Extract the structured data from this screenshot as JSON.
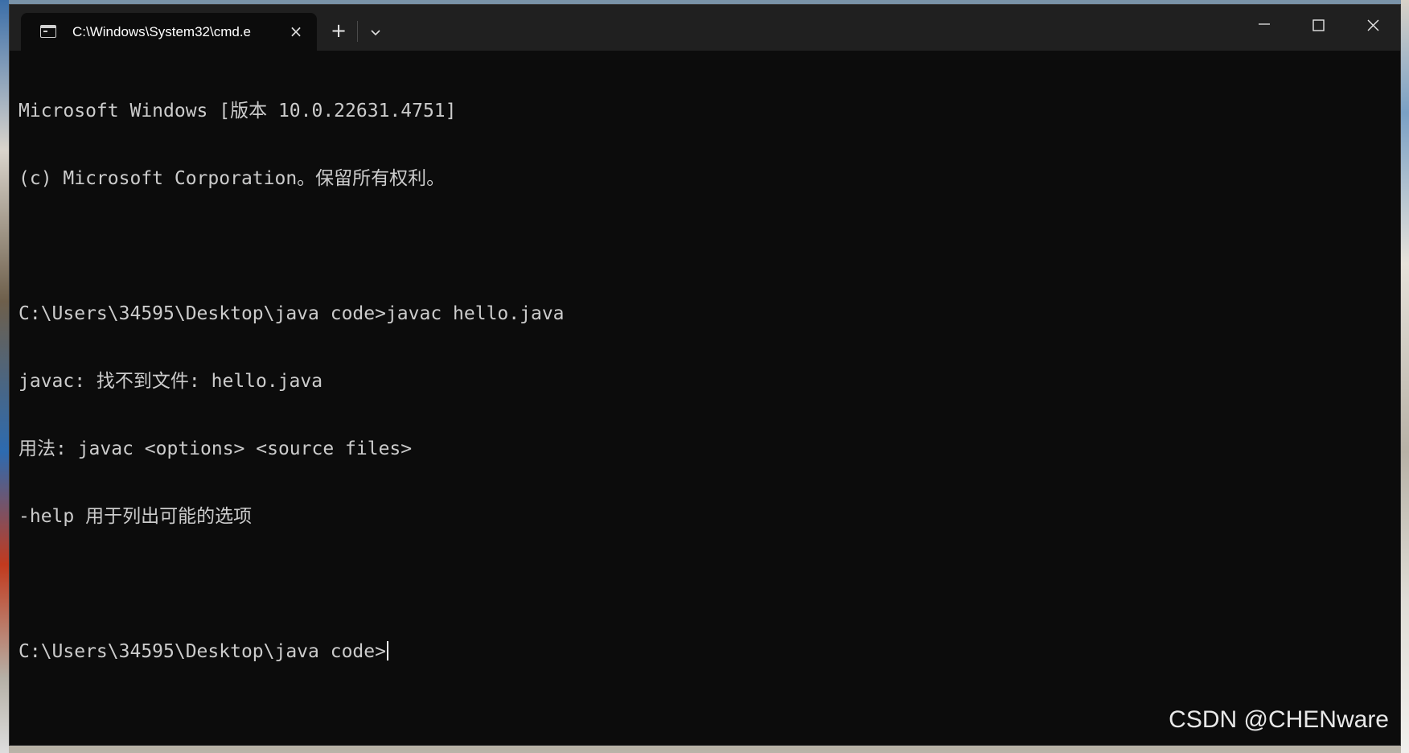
{
  "window": {
    "tab_title": "C:\\Windows\\System32\\cmd.e",
    "tab_close_icon": "×",
    "new_tab_icon": "+",
    "dropdown_icon": "chevron-down-icon",
    "minimize_icon": "minimize-icon",
    "maximize_icon": "maximize-icon",
    "close_icon": "close-icon"
  },
  "console": {
    "lines": [
      "Microsoft Windows [版本 10.0.22631.4751]",
      "(c) Microsoft Corporation。保留所有权利。",
      "",
      "C:\\Users\\34595\\Desktop\\java code>javac hello.java",
      "javac: 找不到文件: hello.java",
      "用法: javac <options> <source files>",
      "-help 用于列出可能的选项",
      "",
      "C:\\Users\\34595\\Desktop\\java code>"
    ],
    "background_color": "#0c0c0c",
    "text_color": "#cccccc"
  },
  "watermark": {
    "text": "CSDN @CHENware"
  }
}
